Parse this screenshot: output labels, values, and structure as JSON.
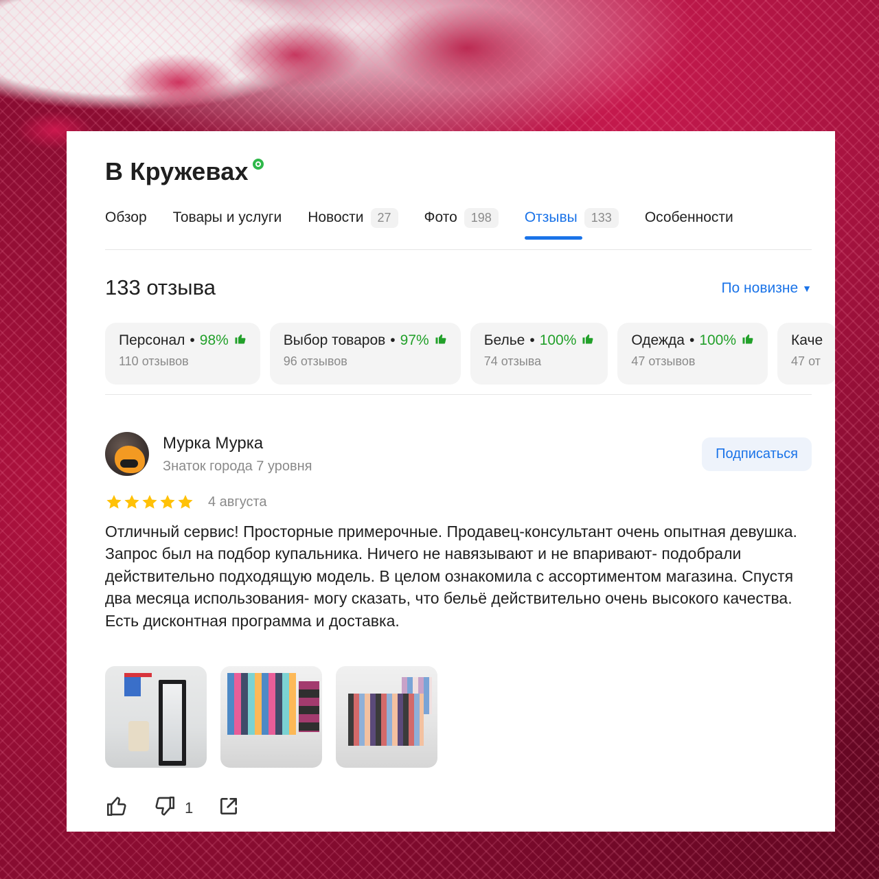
{
  "business": {
    "name": "В Кружевах"
  },
  "tabs": [
    {
      "label": "Обзор",
      "count": null
    },
    {
      "label": "Товары и услуги",
      "count": null
    },
    {
      "label": "Новости",
      "count": "27"
    },
    {
      "label": "Фото",
      "count": "198"
    },
    {
      "label": "Отзывы",
      "count": "133",
      "active": true
    },
    {
      "label": "Особенности",
      "count": null
    }
  ],
  "reviews_header": {
    "title": "133 отзыва",
    "sort_label": "По новизне"
  },
  "aspects": [
    {
      "label": "Персонал",
      "percent": "98%",
      "count": "110 отзывов"
    },
    {
      "label": "Выбор товаров",
      "percent": "97%",
      "count": "96 отзывов"
    },
    {
      "label": "Белье",
      "percent": "100%",
      "count": "74 отзыва"
    },
    {
      "label": "Одежда",
      "percent": "100%",
      "count": "47 отзывов"
    },
    {
      "label": "Каче",
      "percent": "",
      "count": "47 от"
    }
  ],
  "review": {
    "author": "Мурка Мурка",
    "level": "Знаток города 7 уровня",
    "subscribe_label": "Подписаться",
    "rating": 5,
    "date": "4 августа",
    "text": "Отличный сервис! Просторные примерочные. Продавец-консультант очень опытная девушка. Запрос был на подбор купальника. Ничего не навязывают и не впаривают- подобрали действительно подходящую модель. В целом ознакомила с ассортиментом магазина. Спустя два месяца использования- могу сказать, что бельё действительно очень высокого качества. Есть дисконтная программа и доставка.",
    "dislike_count": "1"
  },
  "colors": {
    "accent": "#1a73e8",
    "positive": "#22a02a",
    "star": "#ffc107",
    "verified": "#2fb84a"
  },
  "icons": [
    "verified-badge-icon",
    "caret-down-icon",
    "thumbs-up-icon",
    "thumbs-down-icon",
    "share-icon",
    "star-icon"
  ]
}
